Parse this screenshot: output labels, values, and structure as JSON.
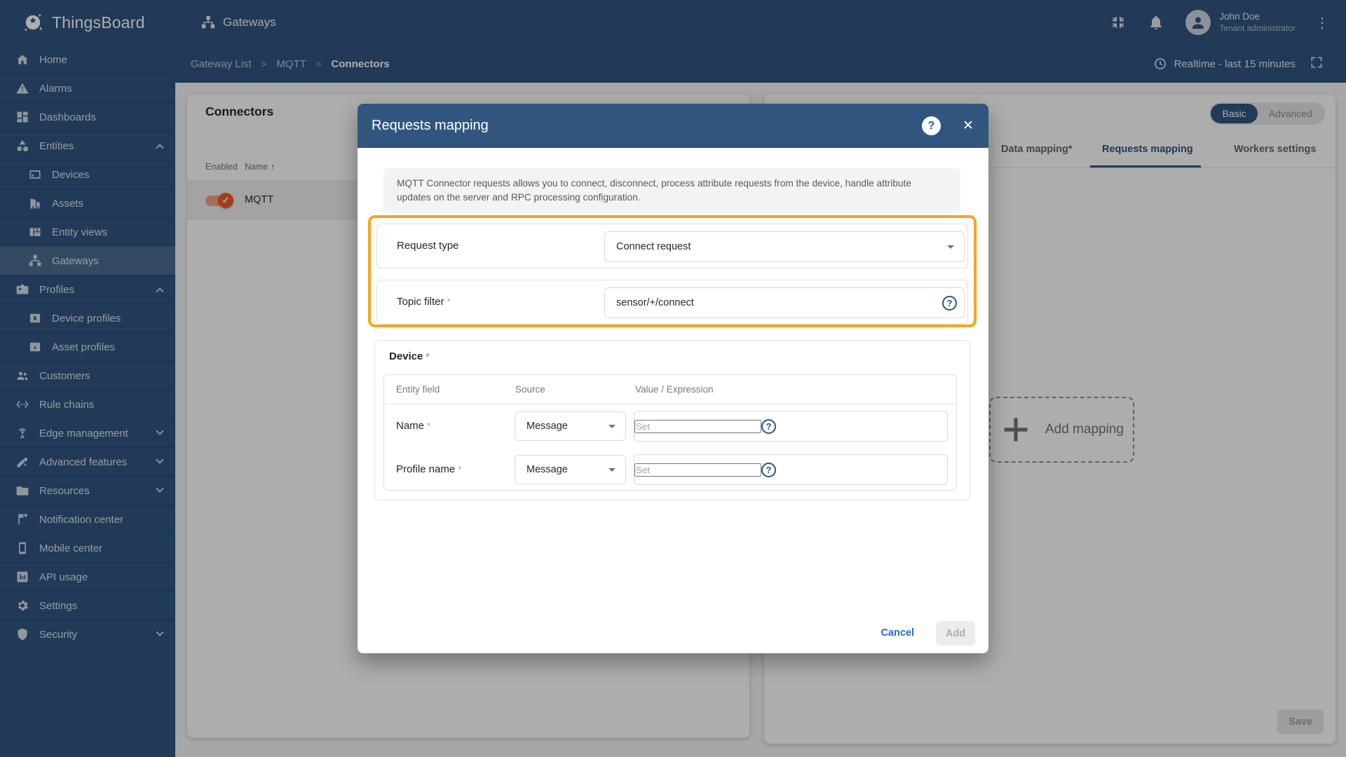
{
  "app": {
    "logo_text": "ThingsBoard"
  },
  "topbar": {
    "title": "Gateways",
    "user": {
      "name": "John Doe",
      "role": "Tenant administrator"
    }
  },
  "breadcrumb": {
    "items": [
      "Gateway List",
      "MQTT",
      "Connectors"
    ],
    "separator": ">"
  },
  "timewindow": {
    "label": "Realtime - last 15 minutes"
  },
  "sidebar": {
    "items": [
      {
        "label": "Home",
        "icon": "home-icon"
      },
      {
        "label": "Alarms",
        "icon": "alarms-icon"
      },
      {
        "label": "Dashboards",
        "icon": "dashboards-icon"
      },
      {
        "label": "Entities",
        "icon": "entities-icon",
        "expanded": true
      },
      {
        "label": "Devices",
        "icon": "devices-icon",
        "sub": true
      },
      {
        "label": "Assets",
        "icon": "assets-icon",
        "sub": true
      },
      {
        "label": "Entity views",
        "icon": "entity-views-icon",
        "sub": true
      },
      {
        "label": "Gateways",
        "icon": "gateways-icon",
        "sub": true,
        "selected": true
      },
      {
        "label": "Profiles",
        "icon": "profiles-icon",
        "expanded": true
      },
      {
        "label": "Device profiles",
        "icon": "device-profiles-icon",
        "sub": true
      },
      {
        "label": "Asset profiles",
        "icon": "asset-profiles-icon",
        "sub": true
      },
      {
        "label": "Customers",
        "icon": "customers-icon"
      },
      {
        "label": "Rule chains",
        "icon": "rule-chains-icon"
      },
      {
        "label": "Edge management",
        "icon": "edge-management-icon",
        "collapsed": true
      },
      {
        "label": "Advanced features",
        "icon": "advanced-features-icon",
        "collapsed": true
      },
      {
        "label": "Resources",
        "icon": "resources-icon",
        "collapsed": true
      },
      {
        "label": "Notification center",
        "icon": "notification-center-icon"
      },
      {
        "label": "Mobile center",
        "icon": "mobile-center-icon"
      },
      {
        "label": "API usage",
        "icon": "api-usage-icon"
      },
      {
        "label": "Settings",
        "icon": "settings-icon"
      },
      {
        "label": "Security",
        "icon": "security-icon",
        "collapsed": true
      }
    ]
  },
  "connectors_panel": {
    "title": "Connectors",
    "columns": [
      "Enabled",
      "Name"
    ],
    "rows": [
      {
        "name": "MQTT",
        "enabled": true
      }
    ]
  },
  "config_panel": {
    "mode_toggle": {
      "options": [
        "Basic",
        "Advanced"
      ],
      "selected": "Basic"
    },
    "tabs": [
      {
        "label": "Data mapping*",
        "active": false
      },
      {
        "label": "Requests mapping",
        "active": true
      },
      {
        "label": "Workers settings",
        "active": false
      }
    ],
    "add_mapping_label": "Add mapping",
    "save_label": "Save"
  },
  "modal": {
    "title": "Requests mapping",
    "description": "MQTT Connector requests allows you to connect, disconnect, process attribute requests from the device, handle attribute updates on the server and RPC processing configuration.",
    "fields": {
      "request_type": {
        "label": "Request type",
        "value": "Connect request"
      },
      "topic_filter": {
        "label": "Topic filter",
        "required_mark": "*",
        "value": "sensor/+/connect"
      }
    },
    "device_section": {
      "title": "Device",
      "required_mark": "*",
      "columns": [
        "Entity field",
        "Source",
        "Value / Expression"
      ],
      "rows": [
        {
          "field": "Name",
          "required_mark": "*",
          "source": "Message",
          "value_placeholder": "Set"
        },
        {
          "field": "Profile name",
          "required_mark": "*",
          "source": "Message",
          "value_placeholder": "Set"
        }
      ]
    },
    "buttons": {
      "cancel": "Cancel",
      "add": "Add"
    }
  },
  "icons": {
    "close": "✕",
    "help": "?",
    "sort_asc": "↑",
    "check": "✓",
    "kebab": "⋮"
  },
  "colors": {
    "primary": "#305680",
    "highlight_orange": "#f5a61e",
    "toggle_on": "#f25b2a",
    "link_blue": "#2a68c0"
  }
}
